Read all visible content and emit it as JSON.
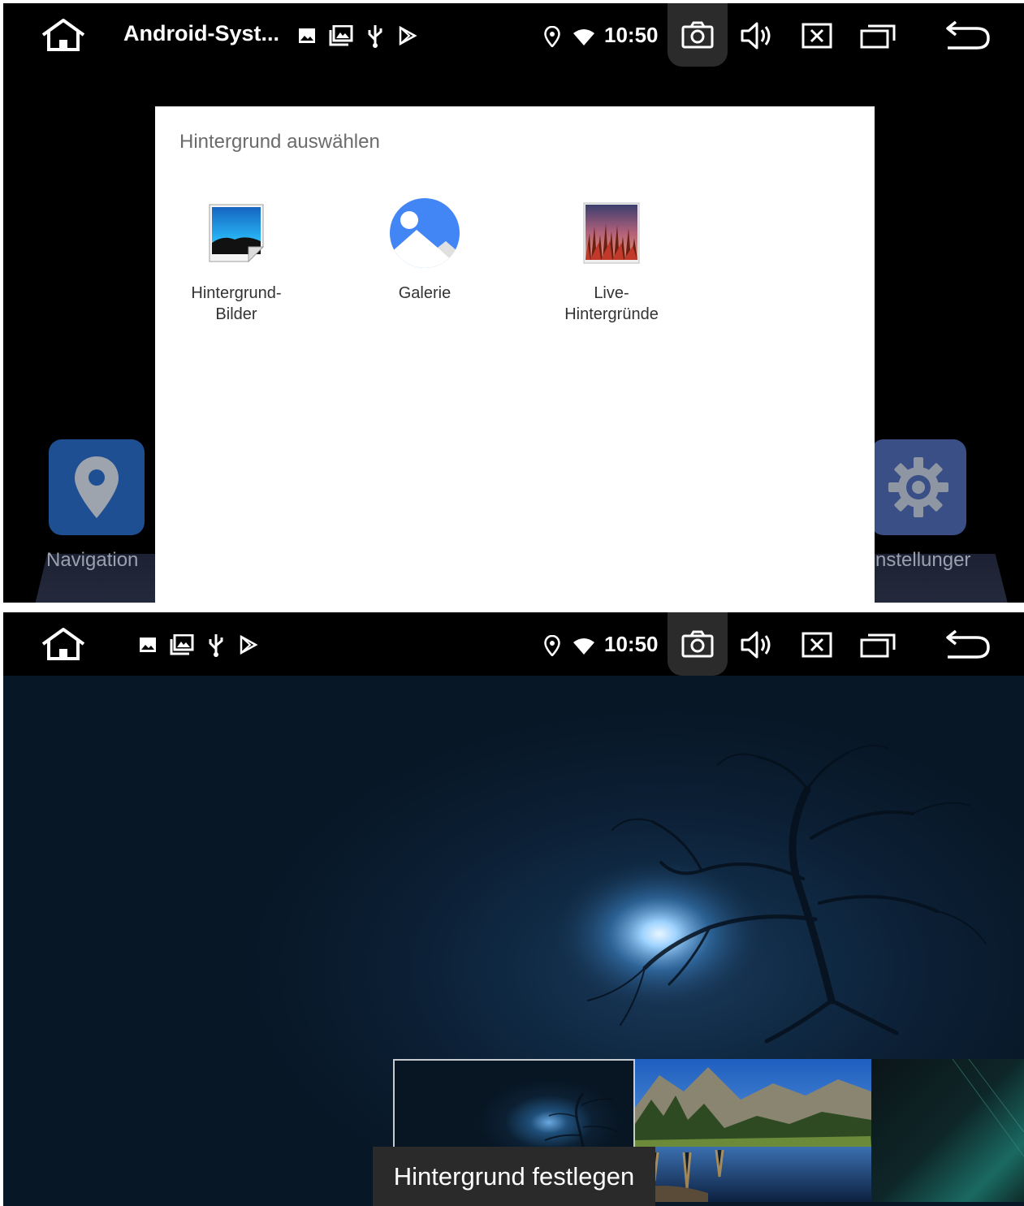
{
  "top_screen": {
    "status_bar": {
      "app_title": "Android-Syst...",
      "time": "10:50",
      "notification_icons": [
        "image-icon",
        "gallery-icon",
        "usb-icon",
        "play-store-icon"
      ],
      "system_icons": [
        "location-icon",
        "wifi-icon"
      ],
      "nav_buttons": [
        "home-icon",
        "screenshot-camera-icon",
        "volume-icon",
        "close-window-icon",
        "recent-apps-icon",
        "back-icon"
      ]
    },
    "dialog": {
      "title": "Hintergrund auswählen",
      "options": [
        {
          "label": "Hintergrund-\nBilder",
          "icon": "wallpaper-pictures-icon"
        },
        {
          "label": "Galerie",
          "icon": "gallery-app-icon"
        },
        {
          "label": "Live-\nHintergründe",
          "icon": "live-wallpapers-icon"
        }
      ]
    },
    "launcher": {
      "left_tile_label": "Navigation",
      "right_tile_label": "nstellunger"
    }
  },
  "bottom_screen": {
    "status_bar": {
      "time": "10:50",
      "notification_icons": [
        "image-icon",
        "gallery-icon",
        "usb-icon",
        "play-store-icon"
      ]
    },
    "thumbnails": [
      "night-tree-moon",
      "mountain-lake",
      "dark-abstract"
    ],
    "set_button_label": "Hintergrund festlegen"
  },
  "colors": {
    "statusbar_bg": "#000000",
    "dialog_bg": "#ffffff",
    "gallery_blue": "#4285f4",
    "nav_tile": "#1f4f93"
  }
}
